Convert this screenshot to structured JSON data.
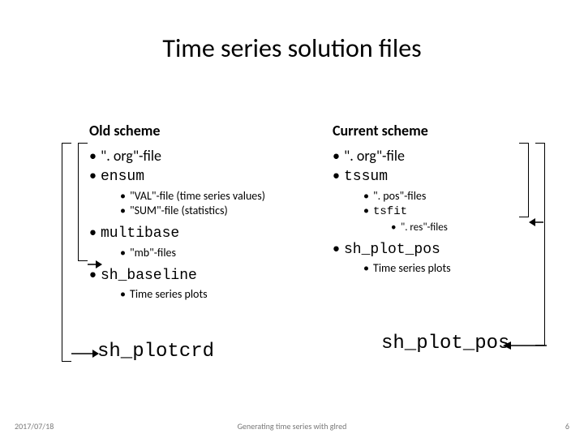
{
  "title": "Time series solution files",
  "left": {
    "heading": "Old scheme",
    "b1": "\". org\"-file",
    "b2": "ensum",
    "b2a": "\"VAL\"-file (time series values)",
    "b2b": "\"SUM\"-file (statistics)",
    "b3": "multibase",
    "b3a": "\"mb\"-files",
    "b4": "sh_baseline",
    "b4a": "Time series plots",
    "cmd": "sh_plotcrd"
  },
  "right": {
    "heading": "Current scheme",
    "b1": "\". org\"-file",
    "b2": "tssum",
    "b2a": "\". pos\"-files",
    "b2b": "tsfit",
    "b2b1": "\". res\"-files",
    "b3": "sh_plot_pos",
    "b3a": "Time series plots",
    "cmd": "sh_plot_pos"
  },
  "footer": {
    "date": "2017/07/18",
    "center": "Generating time series with glred",
    "page": "6"
  }
}
